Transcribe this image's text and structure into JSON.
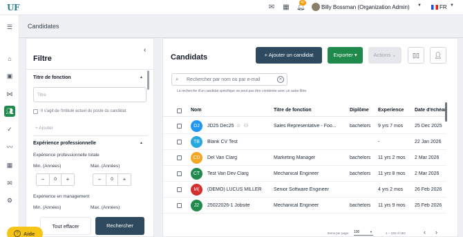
{
  "topbar": {
    "logo": "UF",
    "notification_count": "42",
    "user_name": "Billy Bossman (Organization Admin)",
    "language": "FR"
  },
  "page": {
    "title": "Candidates"
  },
  "filter": {
    "title": "Filtre",
    "job_title_section": "Titre de fonction",
    "job_title_placeholder": "Titre",
    "checkbox_label": "Il s'agit de l'intitulé actuel du poste du candidat",
    "add_label": "+ Ajouter",
    "experience_section": "Expérience professionnelle",
    "total_exp_label": "Expérience professionnelle totale",
    "min_label": "Min. (Années)",
    "max_label": "Max. (Années)",
    "min_value": "0",
    "max_value": "0",
    "mgmt_exp_label": "Expérience en management",
    "min_label2": "Min. (Années)",
    "max_label2": "Max. (Années)",
    "clear_button": "Tout effacer",
    "search_button": "Rechercher"
  },
  "help": {
    "label": "Aide"
  },
  "candidates": {
    "title": "Candidats",
    "add_button": "+ Ajouter un candidat",
    "export_button": "Exporter ▾",
    "actions_button": "Actions ⌄",
    "search_placeholder": "Rechercher par nom ou par e-mail",
    "search_note": "La recherche d'un candidat spécifique ne peut pas être combinée avec un autre filtre.",
    "columns": [
      "Nom",
      "Titre de fonction",
      "Diplôme",
      "Experience",
      "Date d'échéan"
    ],
    "rows": [
      {
        "initials": "DJ",
        "color": "#2196f3",
        "name": "JD25 Dec25",
        "title": "Sales Representative - Foo...",
        "degree": "bachelors",
        "experience": "9 yrs 7 mos",
        "date": "25 Dec 2025"
      },
      {
        "initials": "TB",
        "color": "#29a8e0",
        "name": "Blank CV Test",
        "title": "",
        "degree": "",
        "experience": "-",
        "date": "22 Jan 2026"
      },
      {
        "initials": "CD",
        "color": "#f5a623",
        "name": "Del Van Clarg",
        "title": "Marketing Manager",
        "degree": "bachelors",
        "experience": "11 yrs 2 mos",
        "date": "2 Mar 2026"
      },
      {
        "initials": "CT",
        "color": "#1f8a4c",
        "name": "Test Van Dev Clarg",
        "title": "Mechanical Engineer",
        "degree": "bachelors",
        "experience": "11 yrs 8 mos",
        "date": "2 Mar 2026"
      },
      {
        "initials": "M(",
        "color": "#d32f2f",
        "name": "(DEMO) LUCUS MILLER",
        "title": "Senior Software Engineer",
        "degree": "",
        "experience": "4 yrs 2 mos",
        "date": "26 Feb 2026"
      },
      {
        "initials": "J2",
        "color": "#1f8a4c",
        "name": "25022026-1 Jobsite",
        "title": "Mechanical Engineer",
        "degree": "bachelors",
        "experience": "11 yrs 9 mos",
        "date": "25 Feb 2026"
      }
    ],
    "items_per_page_label": "Items per page:",
    "items_per_page": "100",
    "range": "1 – 100 of 184"
  }
}
